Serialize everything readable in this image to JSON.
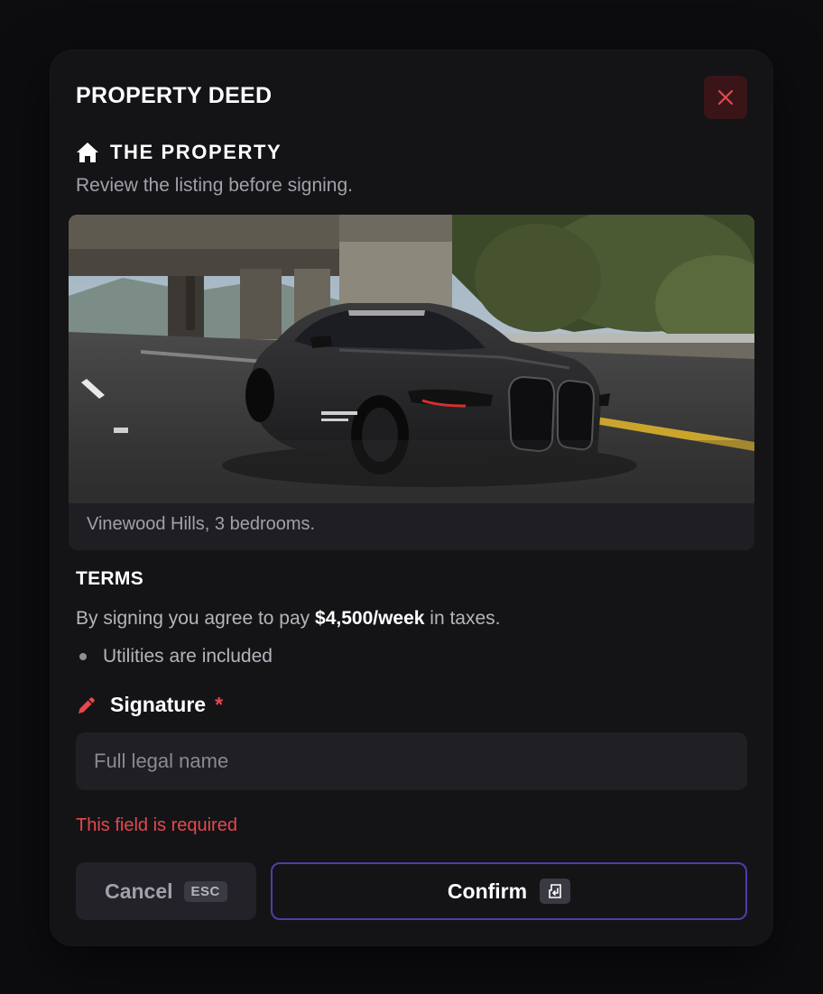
{
  "modal": {
    "title": "PROPERTY DEED",
    "close_icon": "close-icon"
  },
  "property": {
    "heading": "THE PROPERTY",
    "heading_icon": "home-icon",
    "subtitle": "Review the listing before signing.",
    "caption": "Vinewood Hills, 3 bedrooms."
  },
  "terms": {
    "heading": "TERMS",
    "text_before": "By signing you agree to pay ",
    "amount": "$4,500/week",
    "text_after": " in taxes.",
    "bullets": [
      "Utilities are included"
    ]
  },
  "signature": {
    "label": "Signature",
    "required_mark": "*",
    "icon": "pencil-icon",
    "placeholder": "Full legal name",
    "value": "",
    "error": "This field is required"
  },
  "actions": {
    "cancel_label": "Cancel",
    "cancel_shortcut": "ESC",
    "confirm_label": "Confirm",
    "confirm_shortcut_icon": "enter-key-icon"
  },
  "colors": {
    "background": "#0d0d10",
    "modal": "#141417",
    "accent_border": "#4c3fa8",
    "error": "#e5484d",
    "close_bg": "#3a1518"
  }
}
